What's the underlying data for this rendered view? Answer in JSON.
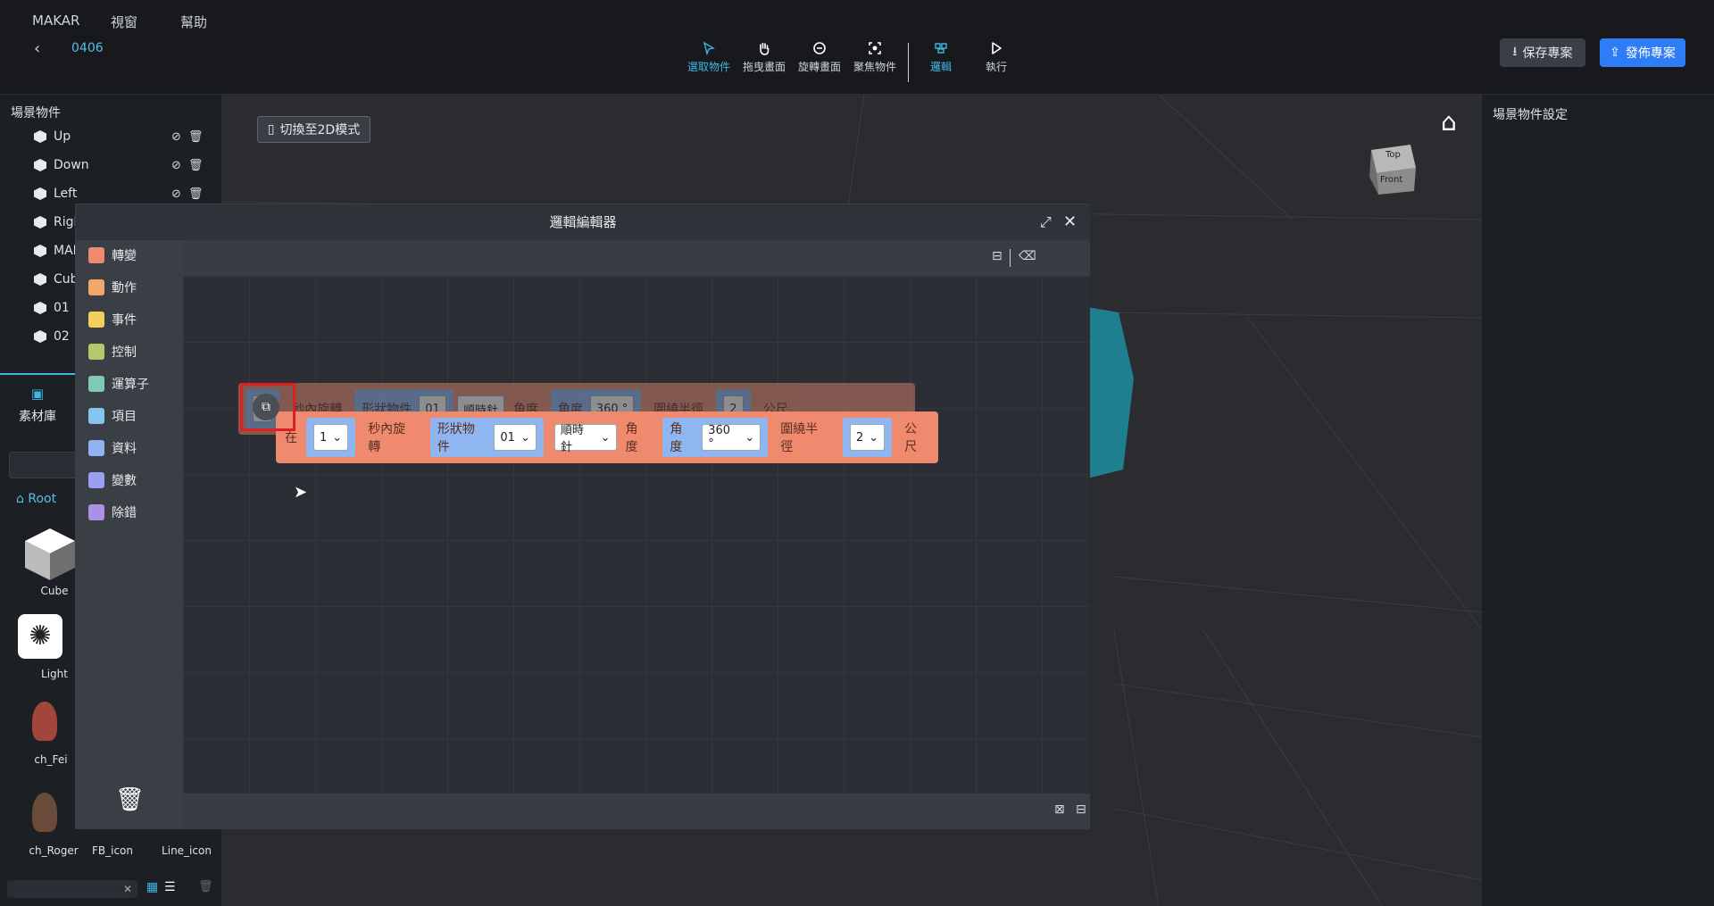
{
  "menu": [
    "MAKAR",
    "視窗",
    "幫助"
  ],
  "project_name": "0406",
  "toolbar": {
    "tools": [
      {
        "label": "選取物件",
        "icon": "cursor-icon",
        "active": true
      },
      {
        "label": "拖曳畫面",
        "icon": "hand-icon",
        "active": false
      },
      {
        "label": "旋轉畫面",
        "icon": "rotate-icon",
        "active": false
      },
      {
        "label": "聚焦物件",
        "icon": "focus-icon",
        "active": false
      },
      {
        "label": "邏輯",
        "icon": "logic-icon",
        "active": true
      },
      {
        "label": "執行",
        "icon": "play-icon",
        "active": false
      }
    ],
    "save_label": "保存專案",
    "publish_label": "發佈專案"
  },
  "scene": {
    "title": "場景物件",
    "objects": [
      "Up",
      "Down",
      "Left",
      "Rigl",
      "MAI",
      "Cub",
      "01",
      "02"
    ]
  },
  "assets": {
    "tab_label": "素材庫",
    "root_label": "Root",
    "items": [
      "Cube",
      "Light",
      "ch_Fei",
      "ch_Roger",
      "FB_icon",
      "Line_icon"
    ]
  },
  "viewport": {
    "switch_2d_label": "切換至2D模式",
    "cube_top": "Top",
    "cube_front": "Front"
  },
  "right_panel": {
    "title": "場景物件設定"
  },
  "editor": {
    "title": "邏輯編輯器",
    "categories": [
      {
        "label": "轉變",
        "color": "#ef8a6f"
      },
      {
        "label": "動作",
        "color": "#f3a86a"
      },
      {
        "label": "事件",
        "color": "#f3cf5a"
      },
      {
        "label": "控制",
        "color": "#b5c86a"
      },
      {
        "label": "運算子",
        "color": "#7fcab7"
      },
      {
        "label": "項目",
        "color": "#85c6ee"
      },
      {
        "label": "資料",
        "color": "#8fb2f0"
      },
      {
        "label": "變數",
        "color": "#9a9ef0"
      },
      {
        "label": "除錯",
        "color": "#ad90e6"
      }
    ],
    "block": {
      "prefix": "在",
      "seconds": "1",
      "rotate_text": "秒內旋轉",
      "shape_label": "形狀物件",
      "shape_value": "01",
      "direction": "順時針",
      "angle_text": "角度",
      "angle_label": "角度",
      "angle_value": "360 °",
      "radius_label": "圍繞半徑",
      "radius_value": "2",
      "unit": "公尺"
    },
    "ghost_block": {
      "seconds": "1",
      "rotate_text": "秒內旋轉",
      "shape_label": "形狀物件",
      "shape_value": "01",
      "direction": "順時針",
      "angle_text": "角度",
      "angle_label": "角度",
      "angle_value": "360 °",
      "radius_label": "圍繞半徑",
      "radius_value": "2",
      "unit": "公尺"
    }
  }
}
